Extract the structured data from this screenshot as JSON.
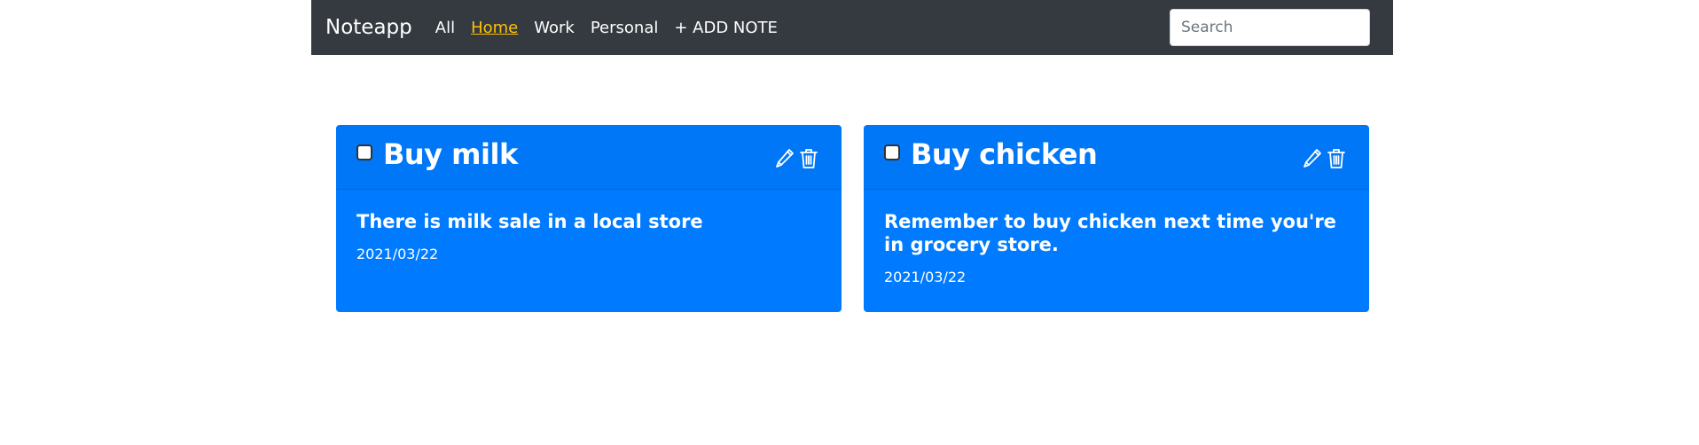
{
  "navbar": {
    "brand": "Noteapp",
    "links": [
      {
        "label": "All",
        "active": false
      },
      {
        "label": "Home",
        "active": true
      },
      {
        "label": "Work",
        "active": false
      },
      {
        "label": "Personal",
        "active": false
      },
      {
        "label": "+ ADD NOTE",
        "active": false
      }
    ],
    "search_placeholder": "Search",
    "background_color": "#343a40",
    "active_link_color": "#ffc107"
  },
  "notes": [
    {
      "title": "Buy milk",
      "text": "There is milk sale in a local store",
      "date": "2021/03/22",
      "checked": false,
      "color": "#007bff",
      "edit_icon": "pencil-icon",
      "delete_icon": "trash-icon"
    },
    {
      "title": "Buy chicken",
      "text": "Remember to buy chicken next time you're in grocery store.",
      "date": "2021/03/22",
      "checked": false,
      "color": "#007bff",
      "edit_icon": "pencil-icon",
      "delete_icon": "trash-icon"
    }
  ]
}
